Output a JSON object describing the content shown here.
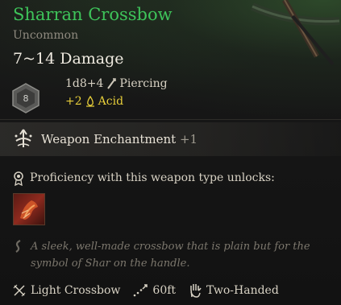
{
  "item": {
    "name": "Sharran Crossbow",
    "rarity": "Uncommon",
    "damage": "7~14 Damage"
  },
  "damage_detail": {
    "die_face": "8",
    "formula": "1d8+4",
    "damage_type": "Piercing",
    "bonus_value": "+2",
    "bonus_type": "Acid"
  },
  "enchantment": {
    "label": "Weapon Enchantment",
    "value": "+1"
  },
  "proficiency": {
    "text": "Proficiency with this weapon type unlocks:"
  },
  "description": "A sleek, well-made crossbow that is plain but for the symbol of Shar on the handle.",
  "footer": {
    "weapon_type": "Light Crossbow",
    "range": "60ft",
    "handedness": "Two-Handed"
  },
  "colors": {
    "name": "#3ec45a",
    "rarity": "#8f8a7f",
    "acid": "#e8cf3a",
    "description": "#7c776d"
  },
  "icons": [
    "d8-die-icon",
    "piercing-icon",
    "acid-icon",
    "enchantment-icon",
    "proficiency-icon",
    "skill-icon",
    "description-icon",
    "light-crossbow-icon",
    "range-icon",
    "two-handed-icon"
  ]
}
